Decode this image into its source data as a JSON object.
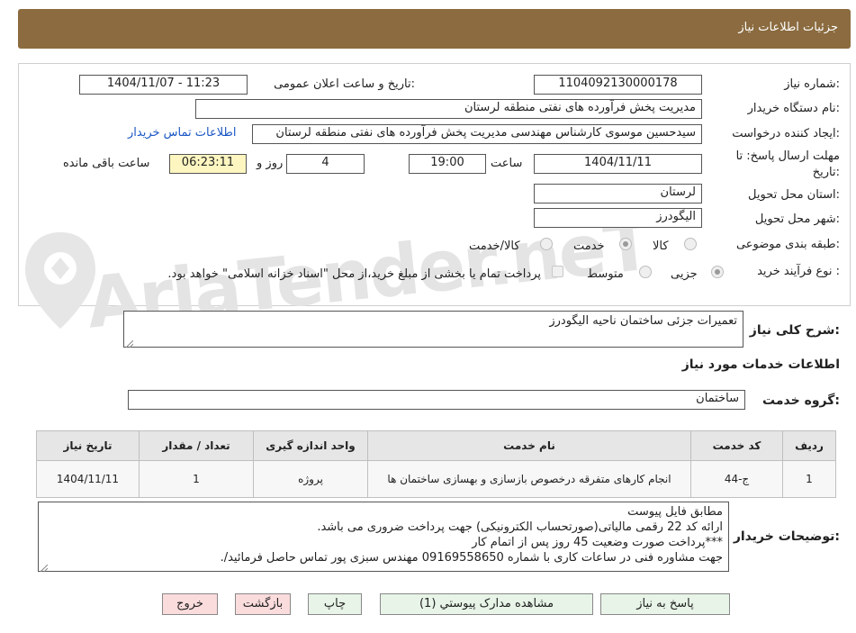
{
  "header": {
    "title": "جزئیات اطلاعات نیاز"
  },
  "watermark": {
    "text": "AriaTender.neT"
  },
  "form": {
    "need_number_label": "شماره نیاز:",
    "need_number": "1104092130000178",
    "announce_label": "تاریخ و ساعت اعلان عمومی:",
    "announce_value": "1404/11/07 - 11:23",
    "buyer_org_label": "نام دستگاه خریدار:",
    "buyer_org": "مدیریت پخش فرآورده های نفتی منطقه لرستان",
    "creator_label": "ایجاد کننده درخواست:",
    "creator": "سیدحسین موسوی کارشناس مهندسی مدیریت پخش فرآورده های نفتی منطقه لرستان",
    "contact_link": "اطلاعات تماس خریدار",
    "deadline_label_1": "مهلت ارسال پاسخ: تا",
    "deadline_label_2": "تاریخ:",
    "deadline_date": "1404/11/11",
    "time_label": "ساعت",
    "deadline_time": "19:00",
    "days_value": "4",
    "days_label": "روز و",
    "remaining_time": "06:23:11",
    "remaining_label": "ساعت باقی مانده",
    "province_label": "استان محل تحویل:",
    "province": "لرستان",
    "city_label": "شهر محل تحویل:",
    "city": "الیگودرز",
    "category_label": "طبقه بندی موضوعی:",
    "category_options": [
      "کالا",
      "خدمت",
      "کالا/خدمت"
    ],
    "category_selected": "خدمت",
    "process_label": "نوع فرآیند خرید :",
    "process_options": [
      "جزیی",
      "متوسط"
    ],
    "process_selected": "جزیی",
    "payment_note": "پرداخت تمام یا بخشی از مبلغ خرید،از محل \"اسناد خزانه اسلامی\" خواهد بود."
  },
  "description": {
    "label": "شرح کلی نیاز:",
    "value": "تعمیرات جزئی ساختمان ناحیه الیگودرز"
  },
  "services": {
    "section_title": "اطلاعات خدمات مورد نیاز",
    "group_label": "گروه خدمت:",
    "group_value": "ساختمان",
    "columns": [
      "ردیف",
      "کد خدمت",
      "نام خدمت",
      "واحد اندازه گیری",
      "تعداد / مقدار",
      "تاریخ نیاز"
    ],
    "rows": [
      [
        "1",
        "ج-44",
        "انجام کارهای متفرقه درخصوص بازسازی و بهسازی ساختمان ها",
        "پروژه",
        "1",
        "1404/11/11"
      ]
    ]
  },
  "buyer_notes": {
    "label": "توضیحات خریدار:",
    "lines": [
      "مطابق فایل پیوست",
      "ارائه کد 22 رقمی مالیاتی(صورتحساب الکترونیکی) جهت پرداخت ضروری می باشد.",
      "***پرداخت صورت وضعیت 45 روز پس از اتمام کار",
      "جهت مشاوره فنی در ساعات کاری با شماره 09169558650 مهندس سبزی پور تماس حاصل فرمائید/."
    ]
  },
  "buttons": {
    "reply": "پاسخ به نیاز",
    "attachments": "مشاهده مدارک پیوستي (1)",
    "print": "چاپ",
    "back": "بازگشت",
    "exit": "خروج"
  }
}
